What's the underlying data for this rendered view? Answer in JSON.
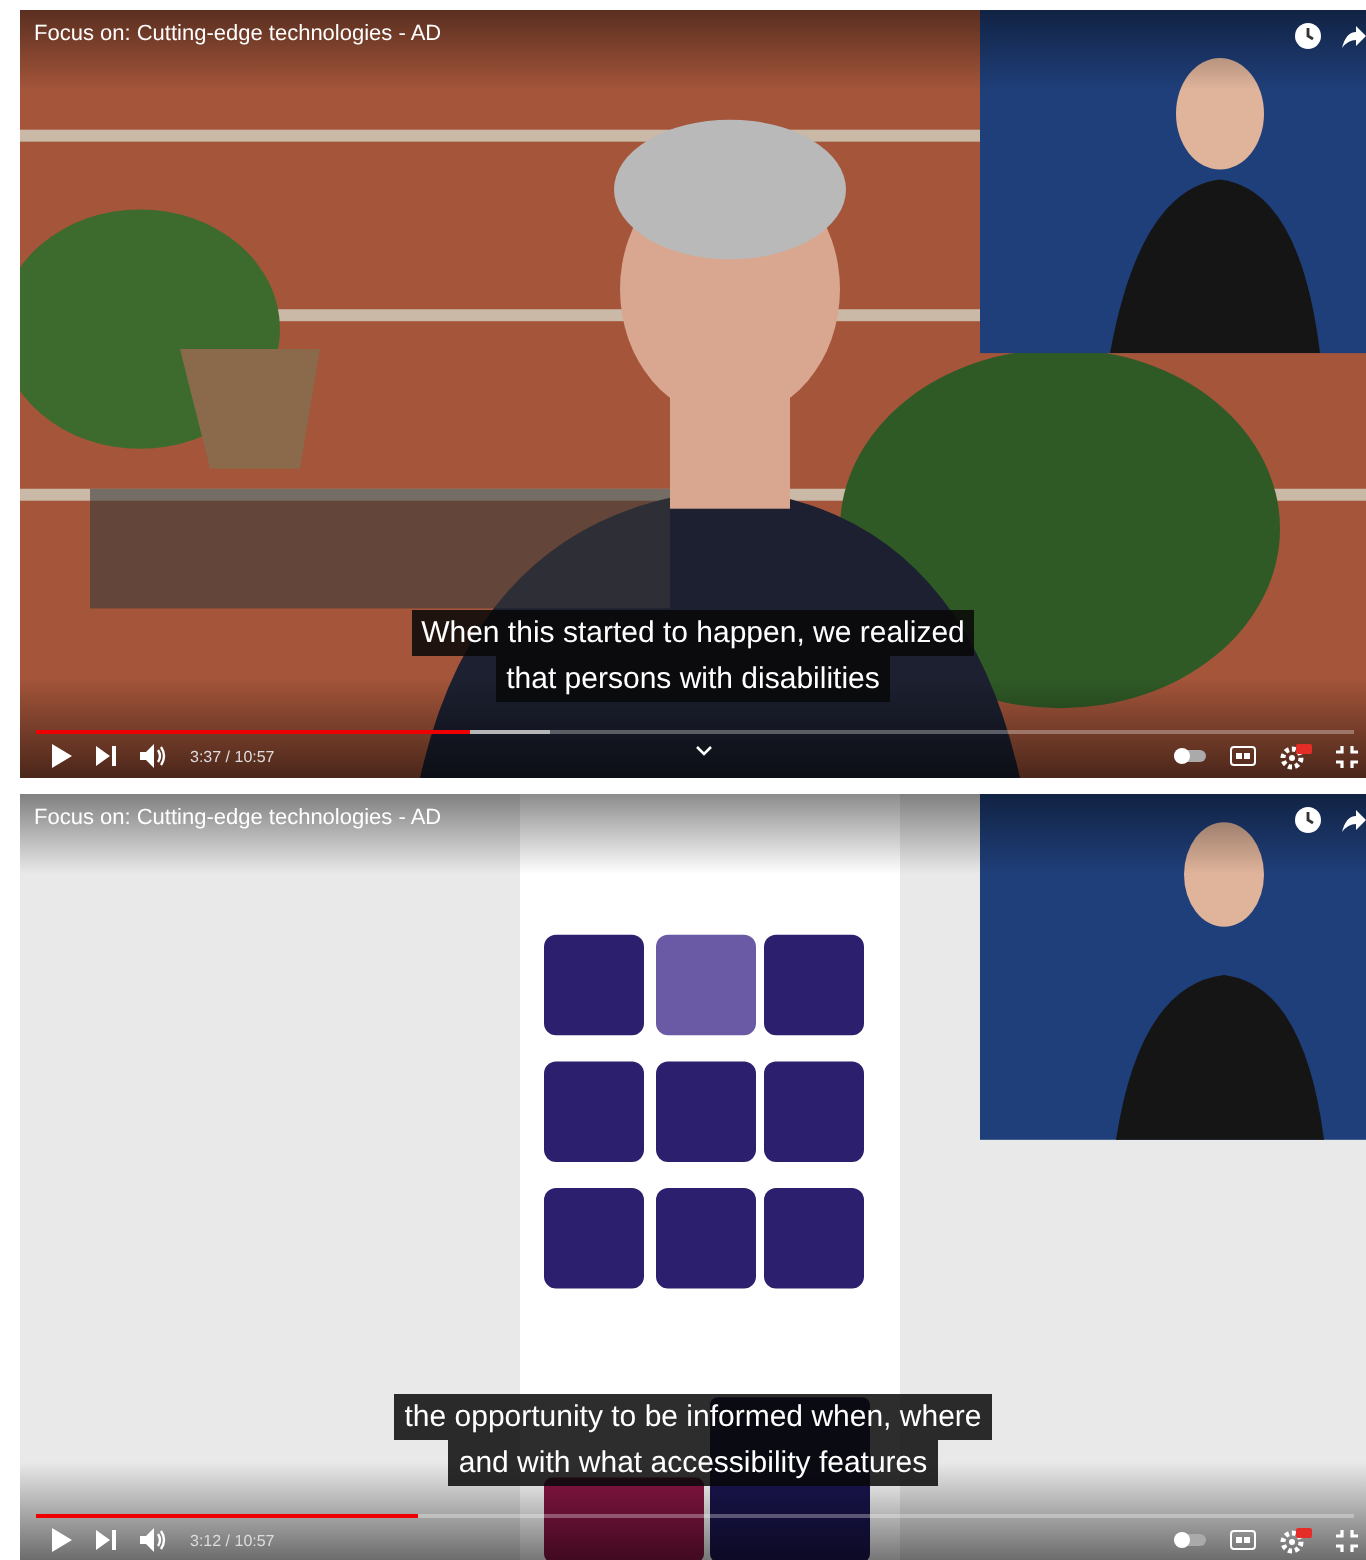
{
  "players": [
    {
      "kind": "brick-interview",
      "title": "Focus on: Cutting-edge technologies - AD",
      "captions": [
        "When this started to happen, we realized",
        "that persons with disabilities"
      ],
      "progress": {
        "level": 0.33
      },
      "buffered": {
        "level": 0.39
      },
      "time": "3:37 / 10:57",
      "chevron": true
    },
    {
      "kind": "app-demo",
      "title": "Focus on: Cutting-edge technologies - AD",
      "captions": [
        "the opportunity to be informed when, where",
        "and with what accessibility features"
      ],
      "progress": {
        "level": 0.29
      },
      "buffered": {
        "level": 0.29
      },
      "time": "3:12 / 10:57",
      "chevron": false
    }
  ]
}
